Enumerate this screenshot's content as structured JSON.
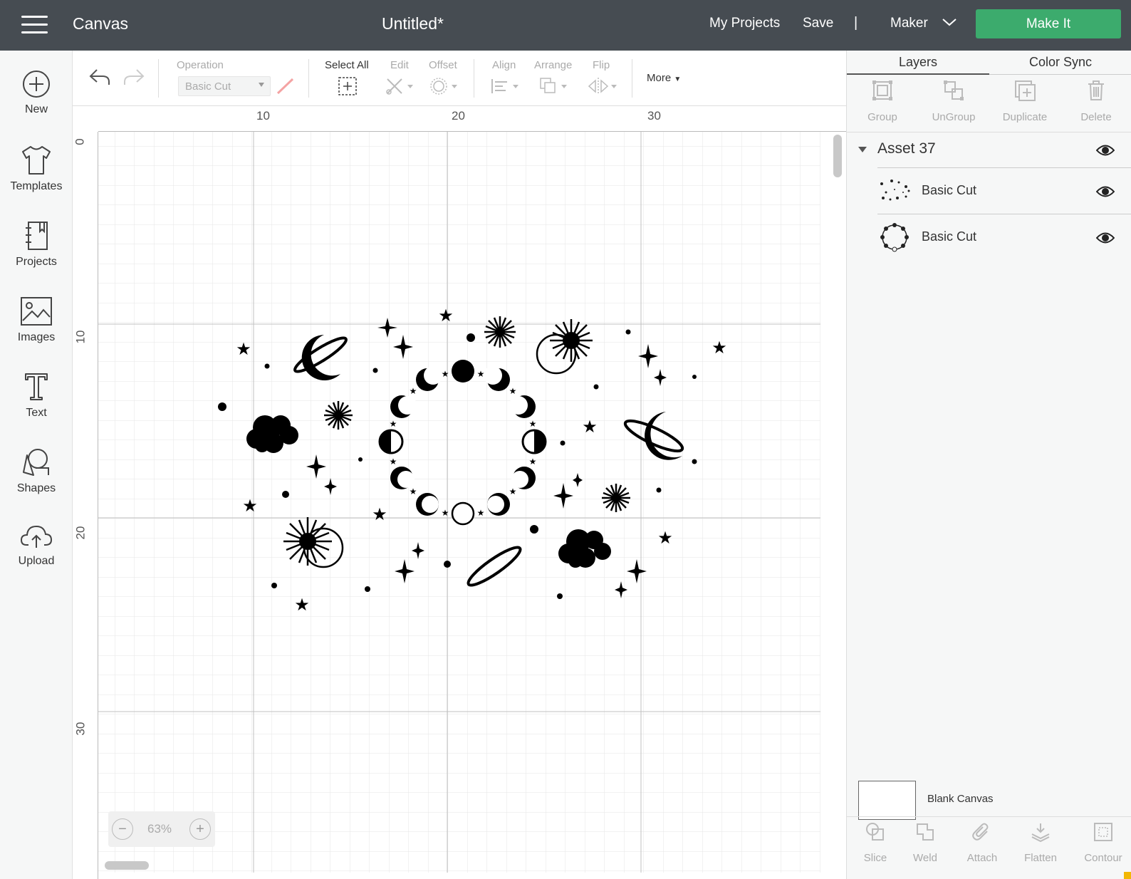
{
  "topbar": {
    "app_title": "Canvas",
    "doc_title": "Untitled*",
    "my_projects": "My Projects",
    "save": "Save",
    "separator": "|",
    "machine": "Maker",
    "make_it": "Make It"
  },
  "nav": {
    "items": [
      {
        "label": "New",
        "icon": "plus-circle-icon"
      },
      {
        "label": "Templates",
        "icon": "tshirt-icon"
      },
      {
        "label": "Projects",
        "icon": "notebook-icon"
      },
      {
        "label": "Images",
        "icon": "image-icon"
      },
      {
        "label": "Text",
        "icon": "text-icon"
      },
      {
        "label": "Shapes",
        "icon": "shapes-icon"
      },
      {
        "label": "Upload",
        "icon": "cloud-upload-icon"
      }
    ]
  },
  "toolbar": {
    "operation_label": "Operation",
    "operation_value": "Basic Cut",
    "select_all": "Select All",
    "edit": "Edit",
    "offset": "Offset",
    "align": "Align",
    "arrange": "Arrange",
    "flip": "Flip",
    "more": "More"
  },
  "canvas": {
    "ruler_top": [
      "10",
      "20",
      "30"
    ],
    "ruler_left": [
      "0",
      "10",
      "20",
      "30"
    ],
    "zoom_level": "63%",
    "zoom_out": "−",
    "zoom_in": "+"
  },
  "panel": {
    "tabs": [
      "Layers",
      "Color Sync"
    ],
    "tools": [
      "Group",
      "UnGroup",
      "Duplicate",
      "Delete"
    ],
    "group_name": "Asset 37",
    "layers": [
      {
        "name": "Basic Cut",
        "thumb": "scatter-thumb"
      },
      {
        "name": "Basic Cut",
        "thumb": "ring-thumb"
      }
    ],
    "blank_canvas": "Blank Canvas",
    "bottom_tools": [
      "Slice",
      "Weld",
      "Attach",
      "Flatten",
      "Contour"
    ]
  },
  "colors": {
    "topbar": "#464c52",
    "make_it": "#3cab6d",
    "grid_minor": "#e6e6e6",
    "grid_major": "#c0c0c0",
    "design": "#000000"
  }
}
